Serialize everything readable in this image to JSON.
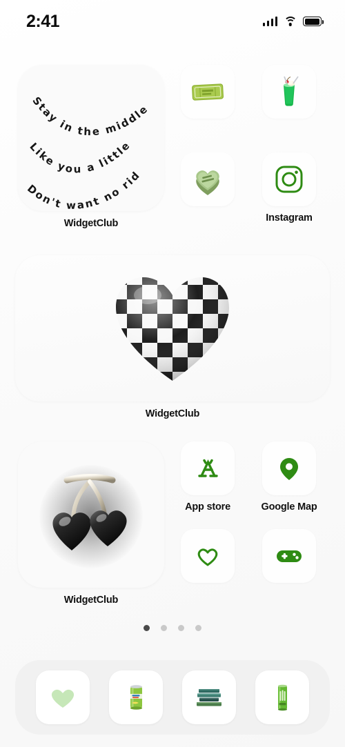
{
  "status_bar": {
    "time": "2:41",
    "cellular_icon": "cellular-signal-icon",
    "wifi_icon": "wifi-icon",
    "battery_icon": "battery-full-icon"
  },
  "theme": {
    "accent_green": "#2e8b13",
    "background": "#ffffff",
    "tile_background": "#fefefe",
    "dock_background": "#f0f0f0",
    "label_color": "#111111"
  },
  "home_screen": {
    "rows": [
      {
        "name": "row-1",
        "quote_widget": {
          "label": "WidgetClub",
          "lines": [
            "Stay in the middle",
            "Like you a little",
            "Don't want no riddle"
          ]
        },
        "apps": [
          {
            "label": "",
            "icon": "ticket-icon",
            "icon_text": "ICE CREAM TICKET"
          },
          {
            "label": "",
            "icon": "melon-soda-drink-icon"
          },
          {
            "label": "",
            "icon": "candy-heart-icon",
            "icon_text": "BE MINE"
          },
          {
            "label": "Instagram",
            "icon": "instagram-icon"
          }
        ]
      },
      {
        "name": "row-2",
        "medium_widget": {
          "label": "WidgetClub",
          "icon": "checkered-heart-balloon-icon"
        }
      },
      {
        "name": "row-3",
        "cherry_widget": {
          "label": "WidgetClub",
          "icon": "black-heart-cherries-icon"
        },
        "apps": [
          {
            "label": "App store",
            "icon": "app-store-icon"
          },
          {
            "label": "Google Map",
            "icon": "map-pin-icon"
          },
          {
            "label": "",
            "icon": "heart-outline-icon"
          },
          {
            "label": "",
            "icon": "game-controller-icon"
          }
        ]
      }
    ],
    "page_dots": {
      "count": 4,
      "active_index": 0
    },
    "dock": {
      "items": [
        {
          "icon": "light-green-heart-icon"
        },
        {
          "icon": "green-soda-can-icon"
        },
        {
          "icon": "green-book-stack-icon"
        },
        {
          "icon": "green-energy-drink-can-icon"
        }
      ]
    }
  }
}
